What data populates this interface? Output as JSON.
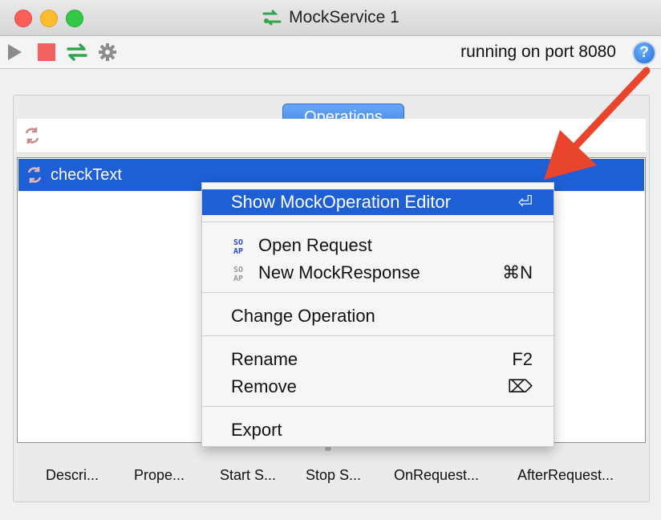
{
  "window": {
    "title": "MockService 1"
  },
  "toolbar": {
    "status": "running on port 8080",
    "help_label": "?"
  },
  "panel": {
    "tab_label": "Operations"
  },
  "list": {
    "items": [
      {
        "label": "checkText"
      }
    ]
  },
  "context_menu": {
    "items": [
      {
        "label": "Show MockOperation Editor",
        "shortcut": "⏎"
      },
      {
        "label": "Open Request",
        "shortcut": ""
      },
      {
        "label": "New MockResponse",
        "shortcut": "⌘N"
      },
      {
        "label": "Change Operation",
        "shortcut": ""
      },
      {
        "label": "Rename",
        "shortcut": "F2"
      },
      {
        "label": "Remove",
        "shortcut": "⌦"
      },
      {
        "label": "Export",
        "shortcut": ""
      }
    ]
  },
  "bottom_tabs": [
    "Descri...",
    "Prope...",
    "Start S...",
    "Stop S...",
    "OnRequest...",
    "AfterRequest..."
  ],
  "colors": {
    "selection": "#1e5fd6",
    "annotation_arrow": "#e8452c",
    "tab_accent": "#3d82e6"
  }
}
